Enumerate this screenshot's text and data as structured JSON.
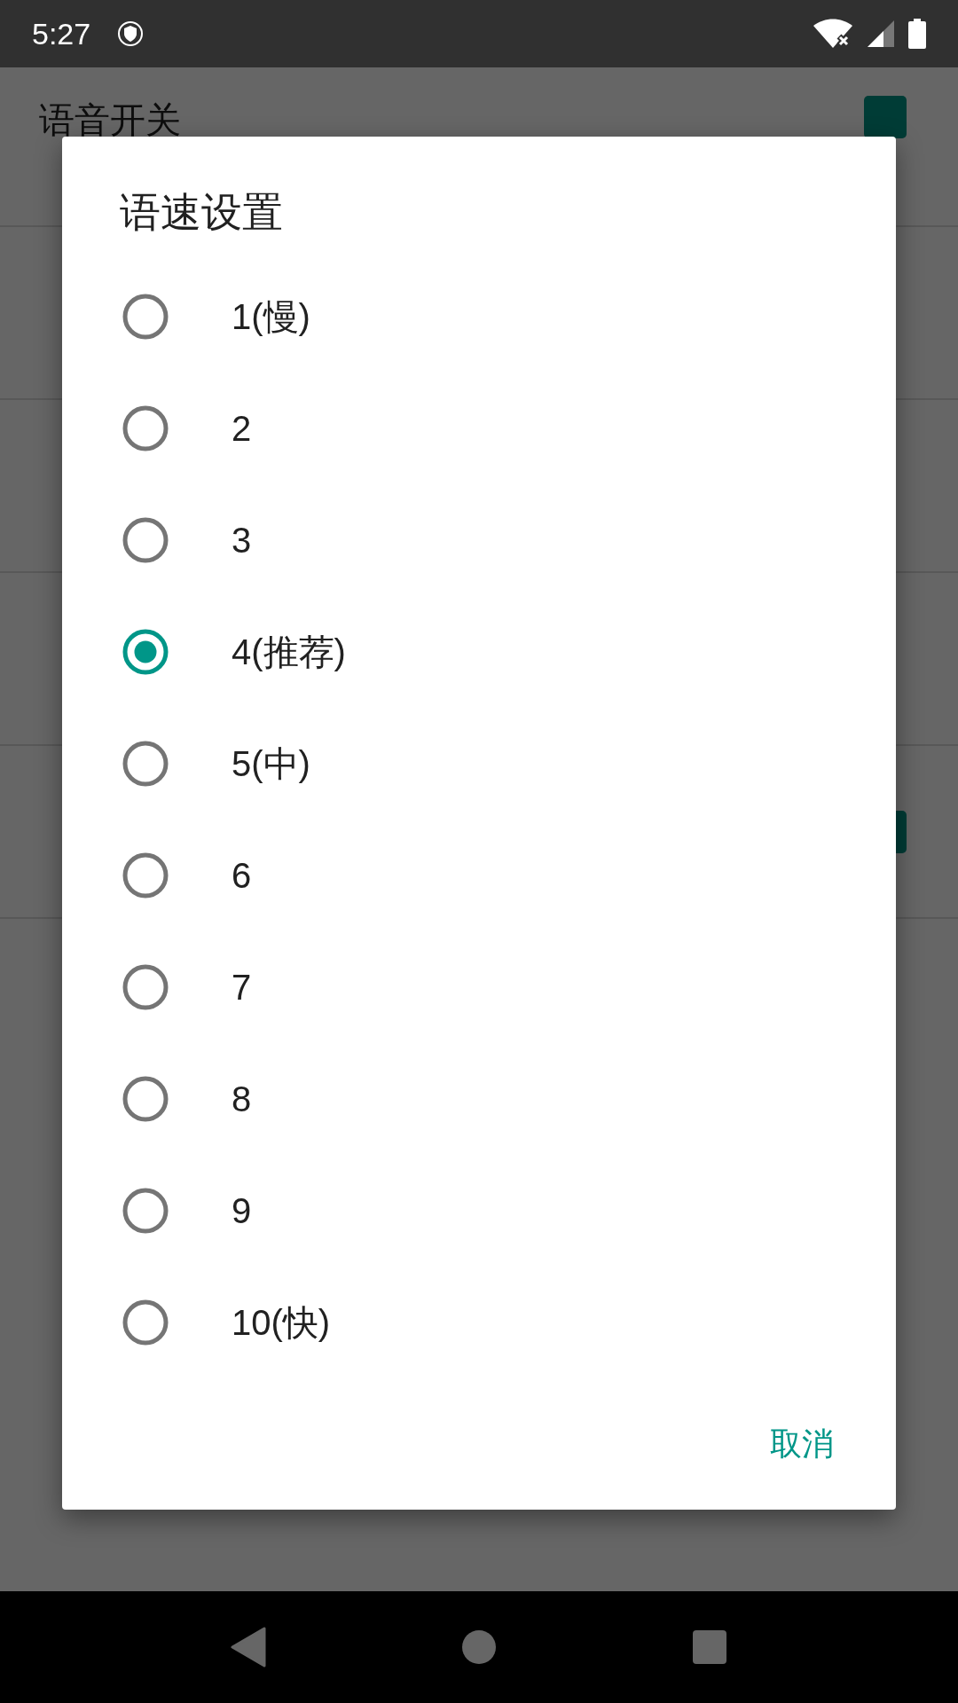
{
  "status_bar": {
    "time": "5:27"
  },
  "settings": [
    {
      "title": "语音开关",
      "kind": "checkbox",
      "checked": true
    },
    {
      "kind": "plain"
    },
    {
      "kind": "plain"
    },
    {
      "kind": "plain"
    },
    {
      "kind": "checkbox",
      "checked": true
    }
  ],
  "dialog": {
    "title": "语速设置",
    "options": [
      {
        "label": "1(慢)",
        "selected": false
      },
      {
        "label": "2",
        "selected": false
      },
      {
        "label": "3",
        "selected": false
      },
      {
        "label": "4(推荐)",
        "selected": true
      },
      {
        "label": "5(中)",
        "selected": false
      },
      {
        "label": "6",
        "selected": false
      },
      {
        "label": "7",
        "selected": false
      },
      {
        "label": "8",
        "selected": false
      },
      {
        "label": "9",
        "selected": false
      },
      {
        "label": "10(快)",
        "selected": false
      }
    ],
    "buttons": [
      "取消"
    ]
  }
}
